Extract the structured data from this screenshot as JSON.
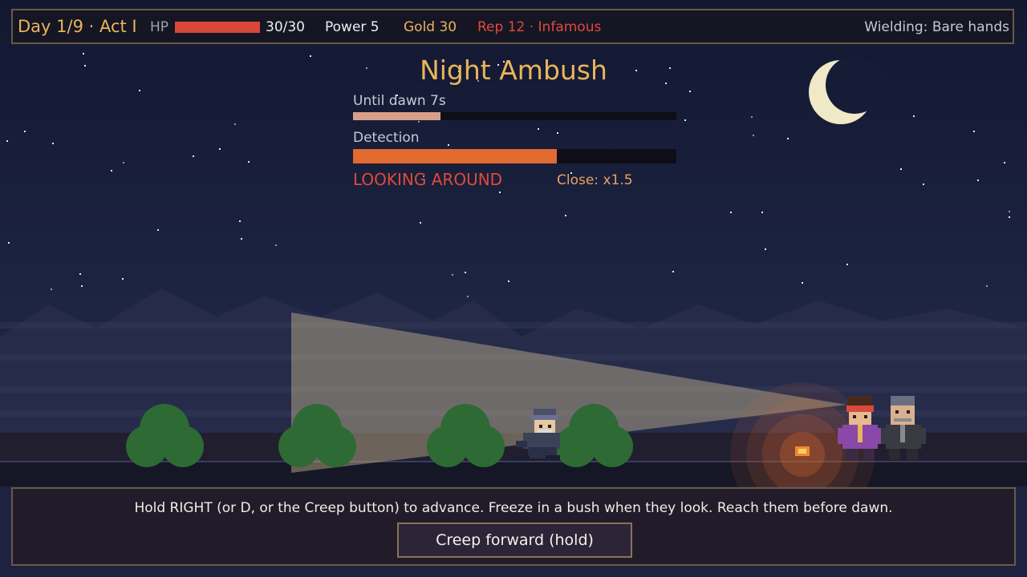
{
  "hud": {
    "day": "Day 1/9 · Act I",
    "hp_label": "HP",
    "hp_value": "30/30",
    "hp_fraction": 1.0,
    "power": "Power 5",
    "gold": "Gold 30",
    "reputation": "Rep 12 · Infamous",
    "wielding": "Wielding: Bare hands"
  },
  "encounter": {
    "title": "Night Ambush",
    "dawn_label": "Until dawn  7s",
    "dawn_fraction": 0.27,
    "detection_label": "Detection",
    "detection_fraction": 0.63,
    "status": "LOOKING AROUND",
    "close_multiplier": "Close: x1.5"
  },
  "instructions": {
    "hint": "Hold RIGHT (or D, or the Creep button) to advance. Freeze in a bush when they look. Reach them before dawn.",
    "creep_button": "Creep forward (hold)"
  },
  "colors": {
    "gold": "#e9b55a",
    "danger": "#e04a3a",
    "hp_bar": "#d8483a",
    "dawn_bar": "#d8a08a",
    "detection_bar": "#e06a30",
    "bush": "#2e6a34"
  },
  "icons": [
    "moon-icon",
    "bush-icon",
    "campfire-icon",
    "player-thief-icon",
    "bandit-purple-icon",
    "bandit-grey-icon"
  ]
}
